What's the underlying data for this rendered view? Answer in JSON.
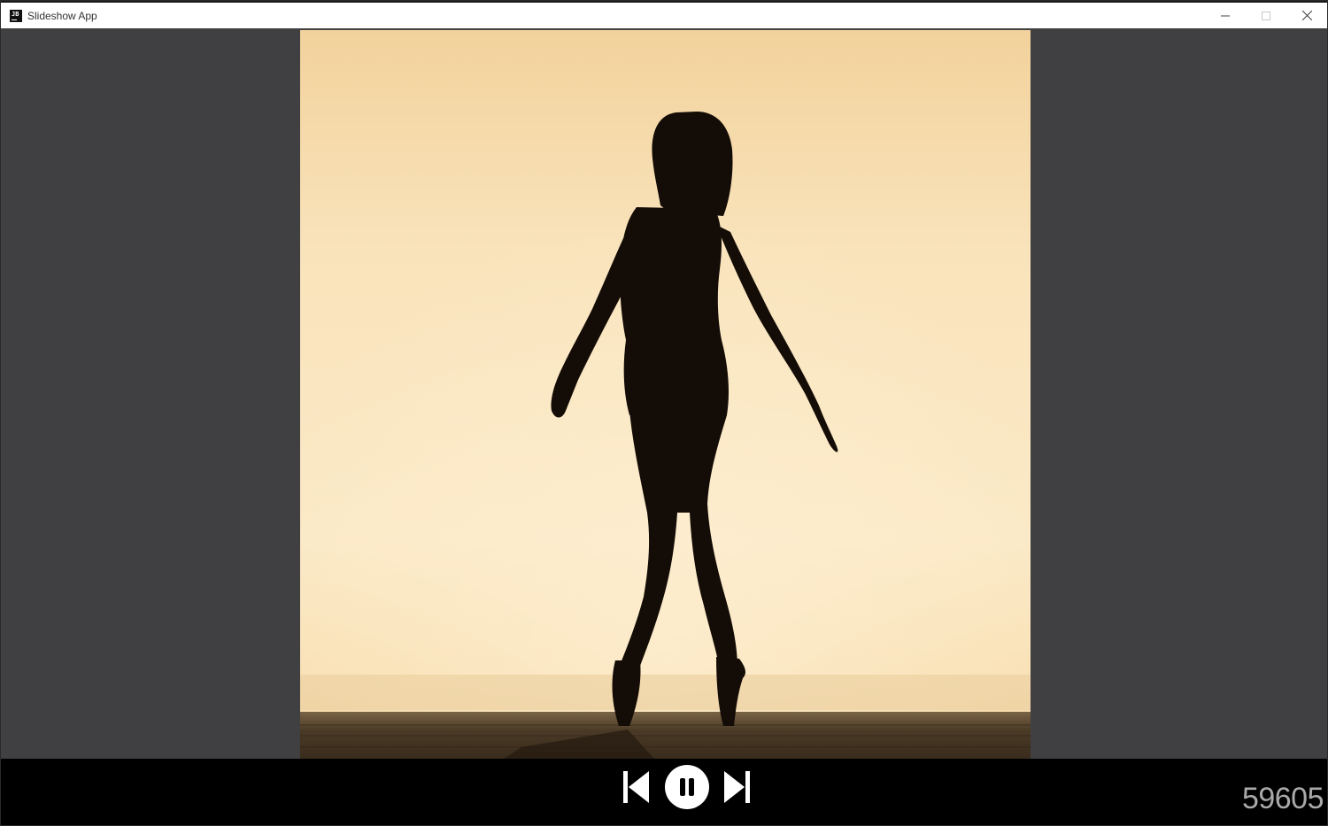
{
  "window": {
    "title": "Slideshow App",
    "app_icon_text": "JB",
    "controls": [
      "minimize-icon",
      "maximize-icon",
      "close-icon"
    ]
  },
  "slideshow": {
    "current_image": "silhouette of dancer on pointe against sunset sky",
    "playing": true,
    "counter": "59605"
  },
  "player_controls": {
    "previous": "skip-previous-icon",
    "play_pause": "pause-icon",
    "next": "skip-next-icon"
  },
  "colors": {
    "stage_bg": "#404042",
    "controls_bg": "#000000",
    "counter_text": "#a9a9a9",
    "control_icons": "#ffffff"
  }
}
